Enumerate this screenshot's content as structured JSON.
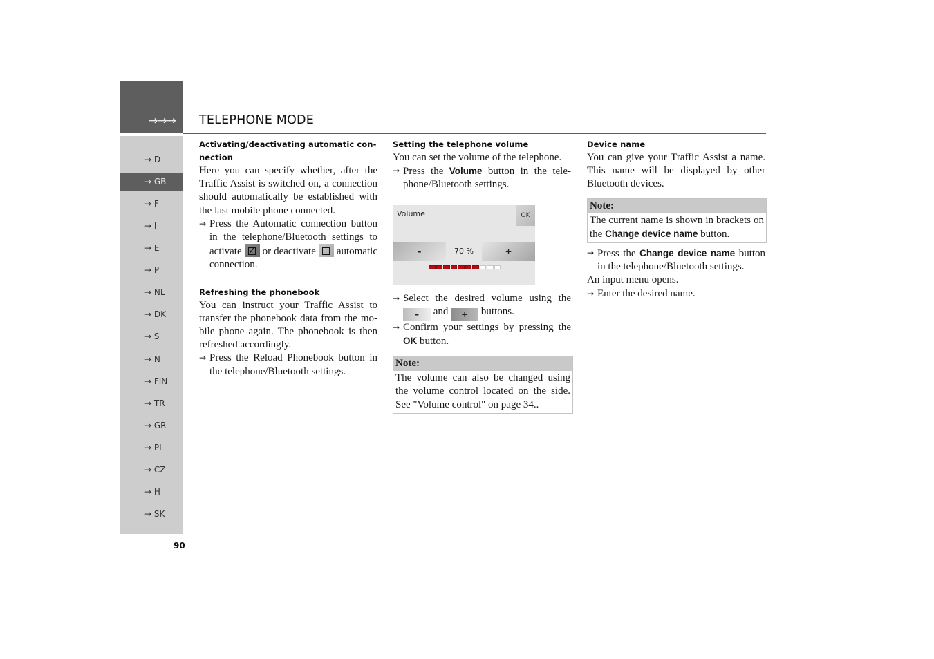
{
  "header": {
    "arrows": "→→→",
    "title": "TELEPHONE MODE"
  },
  "sidebar": {
    "active_index": 1,
    "items": [
      {
        "label": "→ D"
      },
      {
        "label": "→ GB"
      },
      {
        "label": "→ F"
      },
      {
        "label": "→ I"
      },
      {
        "label": "→ E"
      },
      {
        "label": "→ P"
      },
      {
        "label": "→ NL"
      },
      {
        "label": "→ DK"
      },
      {
        "label": "→ S"
      },
      {
        "label": "→ N"
      },
      {
        "label": "→ FIN"
      },
      {
        "label": "→ TR"
      },
      {
        "label": "→ GR"
      },
      {
        "label": "→ PL"
      },
      {
        "label": "→ CZ"
      },
      {
        "label": "→ H"
      },
      {
        "label": "→ SK"
      }
    ]
  },
  "page_number": "90",
  "arrow": "→",
  "col1": {
    "section1": {
      "heading": "Activating/deactivating automatic con-nection",
      "body": "Here you can specify whether, after the Traffic Assist is switched on, a connection should automatically be established with the last mobile phone connected.",
      "step_part1": "Press the Automatic connection button in the telephone/Bluetooth settings to activate",
      "step_part2": "or deactivate",
      "step_part3": "automatic connection."
    },
    "section2": {
      "heading": "Refreshing the phonebook",
      "body": "You can instruct your Traffic Assist to transfer the phonebook data from the mo-bile phone again. The phonebook is then refreshed accordingly.",
      "step": "Press the Reload Phonebook button in the telephone/Bluetooth settings."
    }
  },
  "col2": {
    "heading": "Setting the telephone volume",
    "body": "You can set the volume of the telephone.",
    "step1_pre": "Press the",
    "step1_bold": "Volume",
    "step1_post": "button in the tele-phone/Bluetooth settings.",
    "screen": {
      "title": "Volume",
      "ok": "OK",
      "minus": "–",
      "plus": "+",
      "value_text": "70 %",
      "volume_fraction": 0.7,
      "segments_total": 10
    },
    "step2_pre": "Select the desired volume using the",
    "step2_minus": "–",
    "step2_and": "and",
    "step2_plus": "+",
    "step2_post": "buttons.",
    "step3_pre": "Confirm your settings by pressing the",
    "step3_bold": "OK",
    "step3_post": "button.",
    "note": {
      "head": "Note:",
      "body": "The volume can also be changed using the volume control located on the side. See \"Volume control\" on page 34.."
    }
  },
  "col3": {
    "heading": "Device name",
    "body": "You can give your Traffic Assist a name. This name will be displayed by other Bluetooth devices.",
    "note": {
      "head": "Note:",
      "body_pre": "The current name is shown in brackets on the",
      "body_bold": "Change device name",
      "body_post": "button."
    },
    "step1_pre": "Press the",
    "step1_bold": "Change device name",
    "step1_post": "button in the telephone/Bluetooth settings.",
    "info": "An input menu opens.",
    "step2": "Enter the desired name."
  }
}
